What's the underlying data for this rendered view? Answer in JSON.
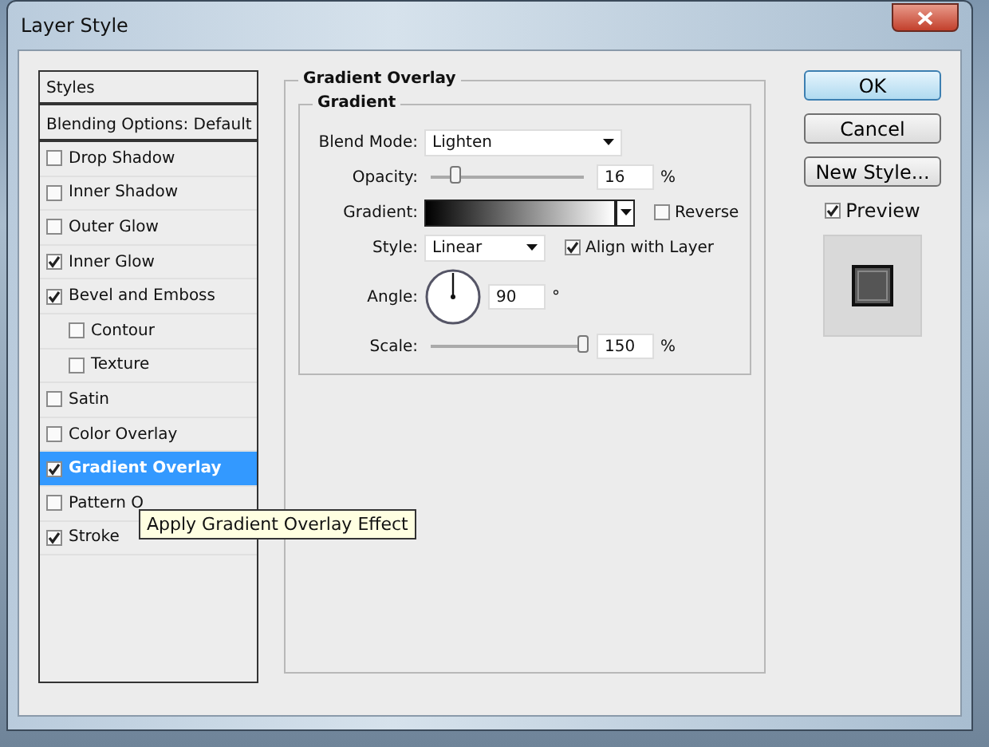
{
  "window": {
    "title": "Layer Style"
  },
  "styles_list": {
    "header": "Styles",
    "blending": "Blending Options: Default",
    "items": [
      {
        "label": "Drop Shadow",
        "checked": false,
        "selected": false,
        "indented": false
      },
      {
        "label": "Inner Shadow",
        "checked": false,
        "selected": false,
        "indented": false
      },
      {
        "label": "Outer Glow",
        "checked": false,
        "selected": false,
        "indented": false
      },
      {
        "label": "Inner Glow",
        "checked": true,
        "selected": false,
        "indented": false
      },
      {
        "label": "Bevel and Emboss",
        "checked": true,
        "selected": false,
        "indented": false
      },
      {
        "label": "Contour",
        "checked": false,
        "selected": false,
        "indented": true
      },
      {
        "label": "Texture",
        "checked": false,
        "selected": false,
        "indented": true
      },
      {
        "label": "Satin",
        "checked": false,
        "selected": false,
        "indented": false
      },
      {
        "label": "Color Overlay",
        "checked": false,
        "selected": false,
        "indented": false
      },
      {
        "label": "Gradient Overlay",
        "checked": true,
        "selected": true,
        "indented": false
      },
      {
        "label": "Pattern O",
        "checked": false,
        "selected": false,
        "indented": false
      },
      {
        "label": "Stroke",
        "checked": true,
        "selected": false,
        "indented": false
      }
    ]
  },
  "tooltip": "Apply Gradient Overlay Effect",
  "panel": {
    "title": "Gradient Overlay",
    "group": "Gradient",
    "blend_mode": {
      "label": "Blend Mode:",
      "value": "Lighten"
    },
    "opacity": {
      "label": "Opacity:",
      "level": 0.17,
      "value": "16",
      "unit": "%"
    },
    "gradient": {
      "label": "Gradient:",
      "reverse": {
        "label": "Reverse",
        "checked": false
      }
    },
    "style": {
      "label": "Style:",
      "value": "Linear",
      "align": {
        "label": "Align with Layer",
        "checked": true
      }
    },
    "angle": {
      "label": "Angle:",
      "value": "90",
      "unit": "°"
    },
    "scale": {
      "label": "Scale:",
      "level": 1,
      "value": "150",
      "unit": "%"
    }
  },
  "buttons": [
    {
      "label": "OK",
      "default": true
    },
    {
      "label": "Cancel",
      "default": false
    },
    {
      "label": "New Style...",
      "default": false
    }
  ],
  "preview": {
    "label": "Preview",
    "checked": true
  }
}
